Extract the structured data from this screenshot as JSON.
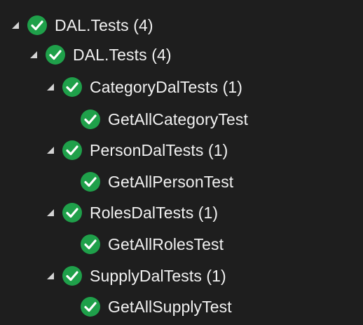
{
  "colors": {
    "background": "#1e1e1e",
    "text": "#f1f1f1",
    "pass_green": "#1fa04a",
    "expander": "#d4d4d4"
  },
  "icons": {
    "expander": "expanded-triangle-icon",
    "status": "test-passed-check-icon"
  },
  "tree": {
    "root": {
      "label": "DAL.Tests (4)",
      "child": {
        "label": "DAL.Tests (4)",
        "classes": [
          {
            "label": "CategoryDalTests (1)",
            "test": "GetAllCategoryTest"
          },
          {
            "label": "PersonDalTests (1)",
            "test": "GetAllPersonTest"
          },
          {
            "label": "RolesDalTests (1)",
            "test": "GetAllRolesTest"
          },
          {
            "label": "SupplyDalTests (1)",
            "test": "GetAllSupplyTest"
          }
        ]
      }
    }
  }
}
